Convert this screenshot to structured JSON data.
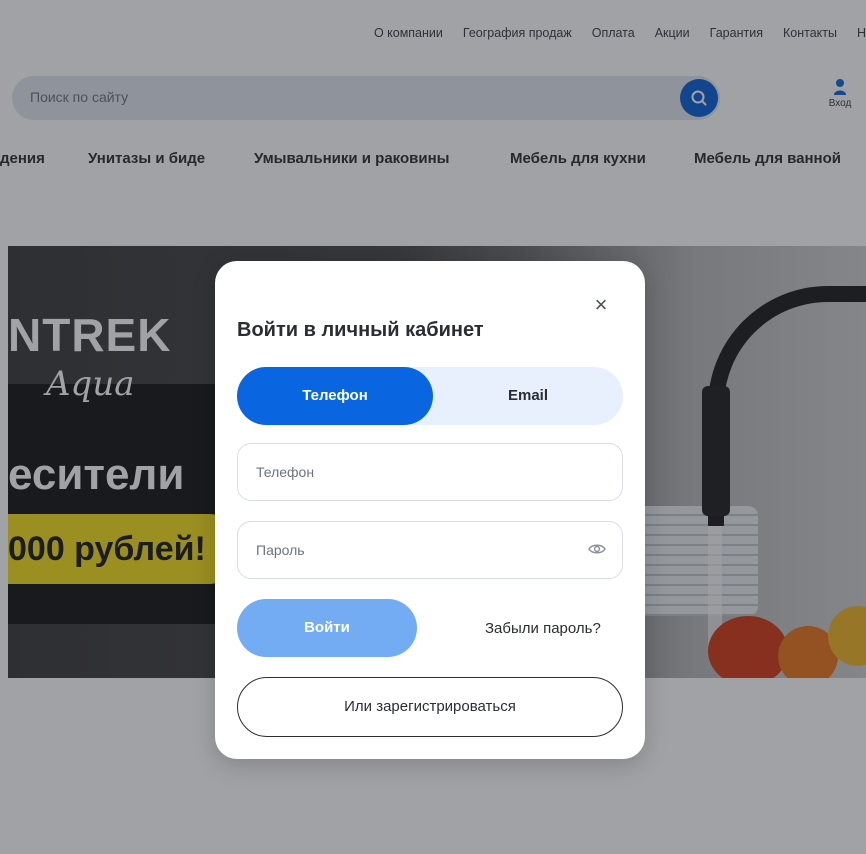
{
  "header": {
    "top_links": [
      "О компании",
      "География продаж",
      "Оплата",
      "Акции",
      "Гарантия",
      "Контакты",
      "Н"
    ],
    "search": {
      "placeholder": "Поиск по сайту"
    },
    "login_label": "Вход"
  },
  "categories": [
    "дения",
    "Унитазы и биде",
    "Умывальники и раковины",
    "Мебель для кухни",
    "Мебель для ванной"
  ],
  "banner": {
    "brand": "NTREK",
    "script": "Aqua",
    "headline": "есители",
    "price": "000 рублей!"
  },
  "modal": {
    "title": "Войти в личный кабинет",
    "close_symbol": "×",
    "tabs": [
      {
        "label": "Телефон",
        "active": true
      },
      {
        "label": "Email",
        "active": false
      }
    ],
    "phone_placeholder": "Телефон",
    "password_placeholder": "Пароль",
    "login_label": "Войти",
    "forgot_label": "Забыли пароль?",
    "register_label": "Или зарегистрироваться"
  },
  "colors": {
    "primary": "#0a66e0",
    "primary_disabled": "#74acf4",
    "tab_bg": "#e7f0fc",
    "overlay": "rgba(30,34,40,0.42)"
  }
}
